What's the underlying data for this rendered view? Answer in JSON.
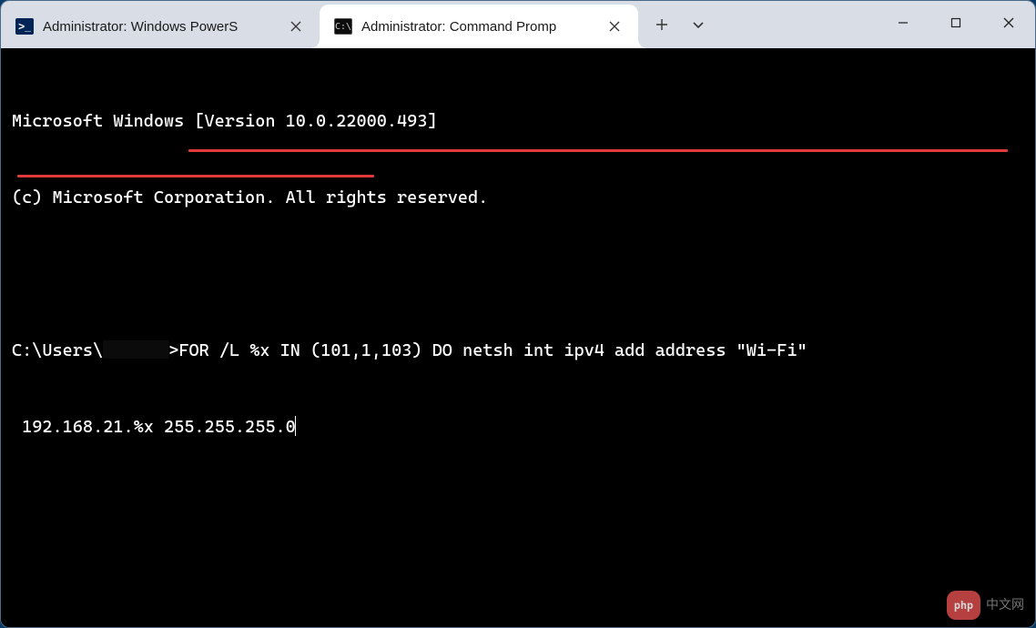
{
  "tabs": [
    {
      "label": "Administrator: Windows PowerS",
      "icon_text": ">_",
      "active": false
    },
    {
      "label": "Administrator: Command Promp",
      "icon_text": "C:\\",
      "active": true
    }
  ],
  "titlebar": {
    "new_tab_tooltip": "New tab",
    "tab_dropdown_tooltip": "New tab dropdown"
  },
  "terminal": {
    "banner_line1": "Microsoft Windows [Version 10.0.22000.493]",
    "banner_line2": "(c) Microsoft Corporation. All rights reserved.",
    "prompt_prefix": "C:\\Users\\",
    "prompt_user_redacted": true,
    "prompt_suffix": ">",
    "command_line1": "FOR /L %x IN (101,1,103) DO netsh int ipv4 add address \"Wi-Fi\"",
    "command_line2": " 192.168.21.%x 255.255.255.0"
  },
  "watermark": {
    "badge": "php",
    "text": "中文网"
  },
  "colors": {
    "underline": "#e03a3a",
    "tabbar_bg": "#d9dee6",
    "active_tab_bg": "#ffffff"
  }
}
